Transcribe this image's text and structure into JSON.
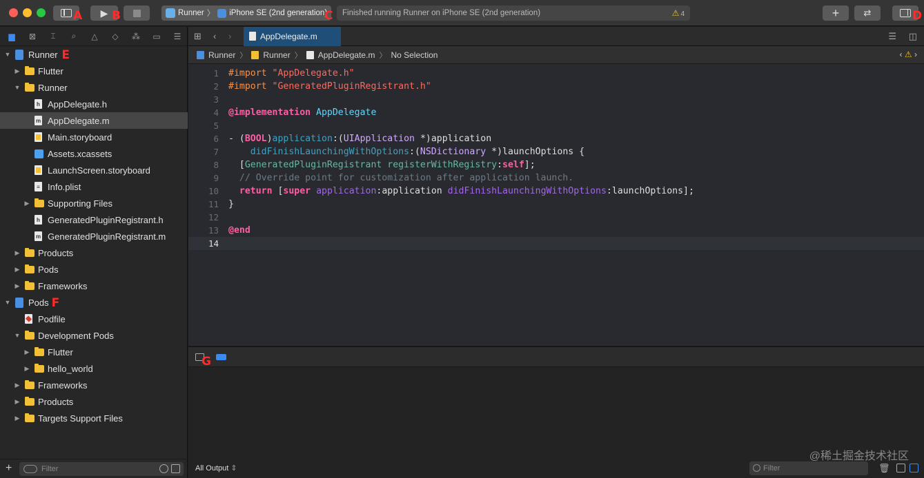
{
  "toolbar": {
    "scheme_project": "Runner",
    "scheme_device": "iPhone SE (2nd generation)",
    "activity_status": "Finished running Runner on iPhone SE (2nd generation)",
    "warning_count": "4",
    "annotations": [
      "A",
      "B",
      "C",
      "D"
    ]
  },
  "navigator": {
    "tree": [
      {
        "label": "Runner",
        "icon": "project-icon",
        "depth": 0,
        "disclosure": "open",
        "annotation": "E"
      },
      {
        "label": "Flutter",
        "icon": "folder-icon",
        "depth": 1,
        "disclosure": "closed"
      },
      {
        "label": "Runner",
        "icon": "folder-icon",
        "depth": 1,
        "disclosure": "open"
      },
      {
        "label": "AppDelegate.h",
        "icon": "header-file-icon",
        "depth": 2,
        "disclosure": "none"
      },
      {
        "label": "AppDelegate.m",
        "icon": "source-file-icon",
        "depth": 2,
        "disclosure": "none",
        "selected": true
      },
      {
        "label": "Main.storyboard",
        "icon": "storyboard-icon",
        "depth": 2,
        "disclosure": "none"
      },
      {
        "label": "Assets.xcassets",
        "icon": "assets-icon",
        "depth": 2,
        "disclosure": "none"
      },
      {
        "label": "LaunchScreen.storyboard",
        "icon": "storyboard-icon",
        "depth": 2,
        "disclosure": "none"
      },
      {
        "label": "Info.plist",
        "icon": "plist-file-icon",
        "depth": 2,
        "disclosure": "none"
      },
      {
        "label": "Supporting Files",
        "icon": "folder-icon",
        "depth": 2,
        "disclosure": "closed"
      },
      {
        "label": "GeneratedPluginRegistrant.h",
        "icon": "header-file-icon",
        "depth": 2,
        "disclosure": "none"
      },
      {
        "label": "GeneratedPluginRegistrant.m",
        "icon": "source-file-icon",
        "depth": 2,
        "disclosure": "none"
      },
      {
        "label": "Products",
        "icon": "folder-icon",
        "depth": 1,
        "disclosure": "closed"
      },
      {
        "label": "Pods",
        "icon": "folder-icon",
        "depth": 1,
        "disclosure": "closed"
      },
      {
        "label": "Frameworks",
        "icon": "folder-icon",
        "depth": 1,
        "disclosure": "closed"
      },
      {
        "label": "Pods",
        "icon": "project-icon",
        "depth": 0,
        "disclosure": "open",
        "annotation": "F"
      },
      {
        "label": "Podfile",
        "icon": "ruby-file-icon",
        "depth": 1,
        "disclosure": "none"
      },
      {
        "label": "Development Pods",
        "icon": "folder-icon",
        "depth": 1,
        "disclosure": "open"
      },
      {
        "label": "Flutter",
        "icon": "folder-icon",
        "depth": 2,
        "disclosure": "closed"
      },
      {
        "label": "hello_world",
        "icon": "folder-icon",
        "depth": 2,
        "disclosure": "closed"
      },
      {
        "label": "Frameworks",
        "icon": "folder-icon",
        "depth": 1,
        "disclosure": "closed"
      },
      {
        "label": "Products",
        "icon": "folder-icon",
        "depth": 1,
        "disclosure": "closed"
      },
      {
        "label": "Targets Support Files",
        "icon": "folder-icon",
        "depth": 1,
        "disclosure": "closed"
      }
    ],
    "filter_placeholder": "Filter"
  },
  "editor": {
    "tab_label": "AppDelegate.m",
    "jump_bar": [
      "Runner",
      "Runner",
      "AppDelegate.m",
      "No Selection"
    ],
    "current_line": 14,
    "code_lines": [
      [
        [
          "kw-pre",
          "#import "
        ],
        [
          "kw-str",
          "\"AppDelegate.h\""
        ]
      ],
      [
        [
          "kw-pre",
          "#import "
        ],
        [
          "kw-str",
          "\"GeneratedPluginRegistrant.h\""
        ]
      ],
      [],
      [
        [
          "kw",
          "@implementation "
        ],
        [
          "ty",
          "AppDelegate"
        ]
      ],
      [],
      [
        [
          "",
          "- ("
        ],
        [
          "kw",
          "BOOL"
        ],
        [
          "",
          ")"
        ],
        [
          "pr",
          "application"
        ],
        [
          "",
          ":("
        ],
        [
          "tyo",
          "UIApplication"
        ],
        [
          "",
          " *)application"
        ]
      ],
      [
        [
          "",
          "    "
        ],
        [
          "pr",
          "didFinishLaunchingWithOptions"
        ],
        [
          "",
          ":("
        ],
        [
          "tyo",
          "NSDictionary"
        ],
        [
          "",
          " *)launchOptions {"
        ]
      ],
      [
        [
          "",
          "  ["
        ],
        [
          "cls",
          "GeneratedPluginRegistrant"
        ],
        [
          "",
          " "
        ],
        [
          "cls",
          "registerWithRegistry"
        ],
        [
          "",
          ":"
        ],
        [
          "kw",
          "self"
        ],
        [
          "",
          "];"
        ]
      ],
      [
        [
          "cmt",
          "  // Override point for customization after application launch."
        ]
      ],
      [
        [
          "",
          "  "
        ],
        [
          "kw",
          "return"
        ],
        [
          "",
          " ["
        ],
        [
          "kw",
          "super"
        ],
        [
          "",
          " "
        ],
        [
          "fnc",
          "application"
        ],
        [
          "",
          ":application "
        ],
        [
          "fnc",
          "didFinishLaunchingWithOptions"
        ],
        [
          "",
          ":launchOptions];"
        ]
      ],
      [
        [
          "",
          "}"
        ]
      ],
      [],
      [
        [
          "kw",
          "@end"
        ]
      ],
      []
    ]
  },
  "debug": {
    "annotation": "G",
    "output_selector": "All Output",
    "filter_placeholder": "Filter"
  },
  "watermark": "@稀土掘金技术社区"
}
